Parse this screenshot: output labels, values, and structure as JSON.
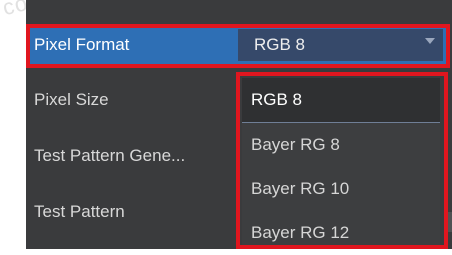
{
  "watermark": "com",
  "properties": {
    "pixel_format_label": "Pixel Format",
    "pixel_format_value": "RGB 8",
    "pixel_size_label": "Pixel Size",
    "test_pattern_gen_label": "Test Pattern Gene...",
    "test_pattern_label": "Test Pattern"
  },
  "dropdown": {
    "options": [
      "RGB 8",
      "Bayer RG 8",
      "Bayer RG 10",
      "Bayer RG 12"
    ],
    "selected_index": 0
  },
  "colors": {
    "highlight_red": "#e0161f",
    "selection_blue": "#2e6fb5",
    "panel_bg": "#3a3b3d"
  }
}
